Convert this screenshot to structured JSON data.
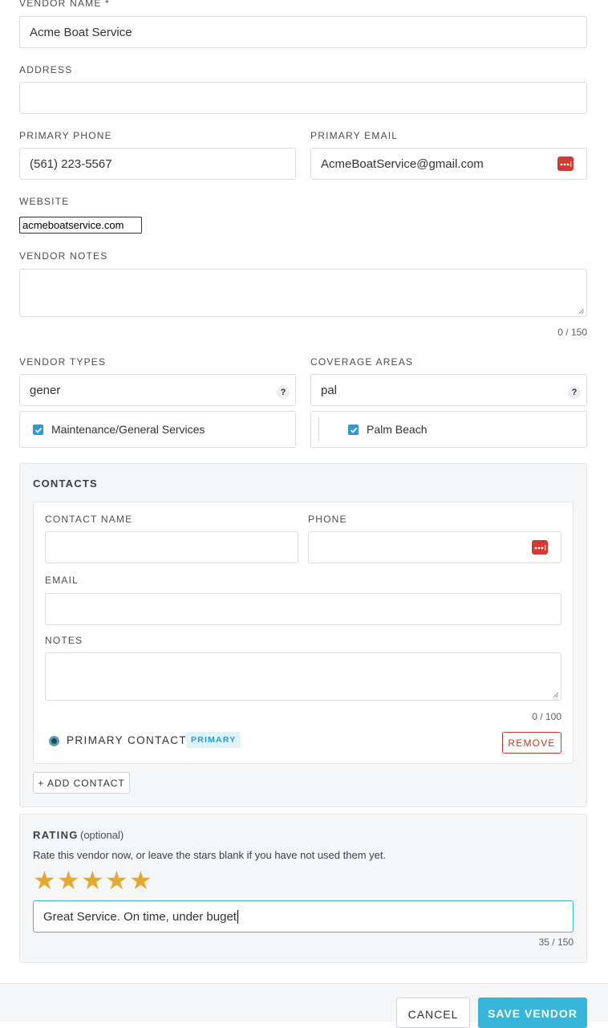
{
  "vendor_name": {
    "label": "VENDOR NAME *",
    "value": "Acme Boat Service"
  },
  "address": {
    "label": "ADDRESS",
    "value": ""
  },
  "primary_phone": {
    "label": "PRIMARY PHONE",
    "value": "(561) 223-5567"
  },
  "primary_email": {
    "label": "PRIMARY EMAIL",
    "value": "AcmeBoatService@gmail.com",
    "icon": "password-manager-icon"
  },
  "website": {
    "label": "WEBSITE",
    "value": "acmeboatservice.com"
  },
  "vendor_notes": {
    "label": "VENDOR NOTES",
    "value": "",
    "counter": "0 / 150"
  },
  "vendor_types": {
    "label": "VENDOR TYPES",
    "query": "gener",
    "help": "?",
    "options": [
      {
        "label": "Maintenance/General Services",
        "checked": true
      }
    ]
  },
  "coverage_areas": {
    "label": "COVERAGE AREAS",
    "query": "pal",
    "help": "?",
    "options": [
      {
        "label": "Palm Beach",
        "checked": true
      }
    ]
  },
  "contacts": {
    "title": "CONTACTS",
    "items": [
      {
        "name_label": "CONTACT NAME",
        "name_value": "",
        "phone_label": "PHONE",
        "phone_value": "",
        "email_label": "EMAIL",
        "email_value": "",
        "notes_label": "NOTES",
        "notes_value": "",
        "notes_counter": "0 / 100",
        "primary_label": "PRIMARY CONTACT",
        "primary_badge": "PRIMARY",
        "primary_selected": true,
        "remove_label": "REMOVE"
      }
    ],
    "add_label": "+ ADD CONTACT"
  },
  "rating": {
    "title": "RATING",
    "optional": "(optional)",
    "hint": "Rate this vendor now, or leave the stars blank if you have not used them yet.",
    "stars": 5,
    "max_stars": 5,
    "star_glyph": "★",
    "star_color": "#e3a935",
    "comment": "Great Service. On time, under buget",
    "counter": "35 / 150"
  },
  "footer": {
    "cancel_label": "CANCEL",
    "save_label": "SAVE VENDOR"
  },
  "colors": {
    "accent": "#38b6da",
    "remove_red": "#c0392b",
    "badge_bg": "#e0f3f9",
    "badge_text": "#2b9cc2"
  }
}
